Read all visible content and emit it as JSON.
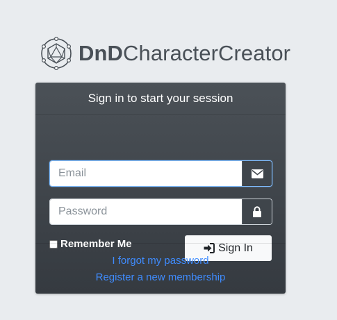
{
  "brand": {
    "logo_icon": "d20-dice-icon",
    "name_bold": "DnD",
    "name_light": "CharacterCreator"
  },
  "login": {
    "heading": "Sign in to start your session",
    "email_placeholder": "Email",
    "password_placeholder": "Password",
    "remember_label": "Remember Me",
    "signin_label": "Sign In",
    "forgot_link": "I forgot my password",
    "register_link": "Register a new membership"
  },
  "icons": {
    "email": "envelope-icon",
    "password": "lock-icon",
    "signin": "sign-in-icon"
  },
  "colors": {
    "page_background": "#e9ecef",
    "card_top": "#4b5157",
    "card_bottom": "#353a40",
    "link": "#3f8cff",
    "focus_border": "#80bdff"
  }
}
